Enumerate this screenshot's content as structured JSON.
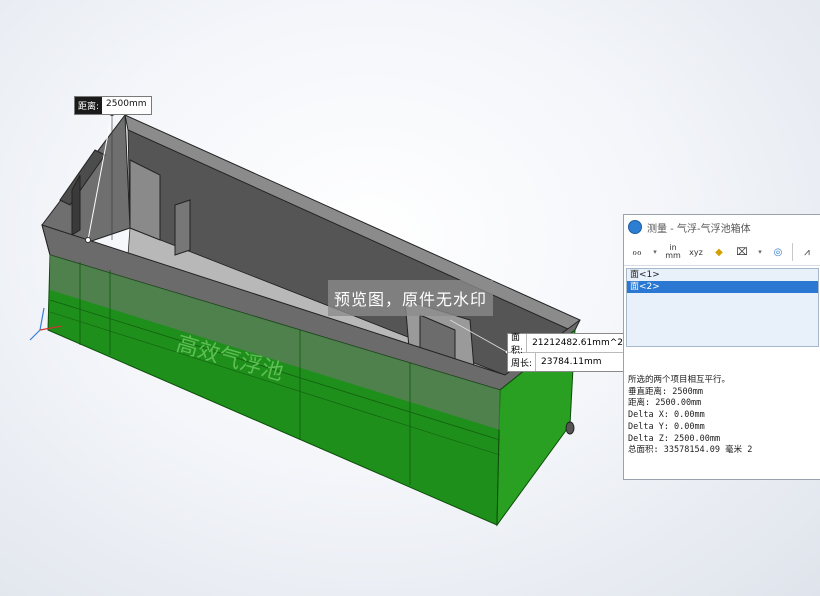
{
  "distance_callout": {
    "label": "距离:",
    "value": "2500mm"
  },
  "face_callout": {
    "area_label": "面积:",
    "area_value": "21212482.61mm^2",
    "perimeter_label": "周长:",
    "perimeter_value": "23784.11mm"
  },
  "watermark": "预览图，原件无水印",
  "model_text": "高效气浮池",
  "measure_panel": {
    "title": "测量 - 气浮-气浮池箱体",
    "toolbar": [
      "arc-options-icon",
      "units-icon",
      "xyz-icon",
      "point-to-point-icon",
      "projection-icon",
      "history-icon",
      "sensor-icon"
    ],
    "selections": [
      "面<1>",
      "面<2>"
    ],
    "results": [
      "所选的两个项目相互平行。",
      "垂直距离: 2500mm",
      "距离: 2500.00mm",
      "Delta X: 0.00mm",
      "Delta Y: 0.00mm",
      "Delta Z: 2500.00mm",
      "总面积: 33578154.09 毫米 2"
    ]
  },
  "colors": {
    "green_face": "#1e8f1a",
    "tank_gray": "#6b6b6b",
    "highlight_blue": "#2b78d2"
  }
}
